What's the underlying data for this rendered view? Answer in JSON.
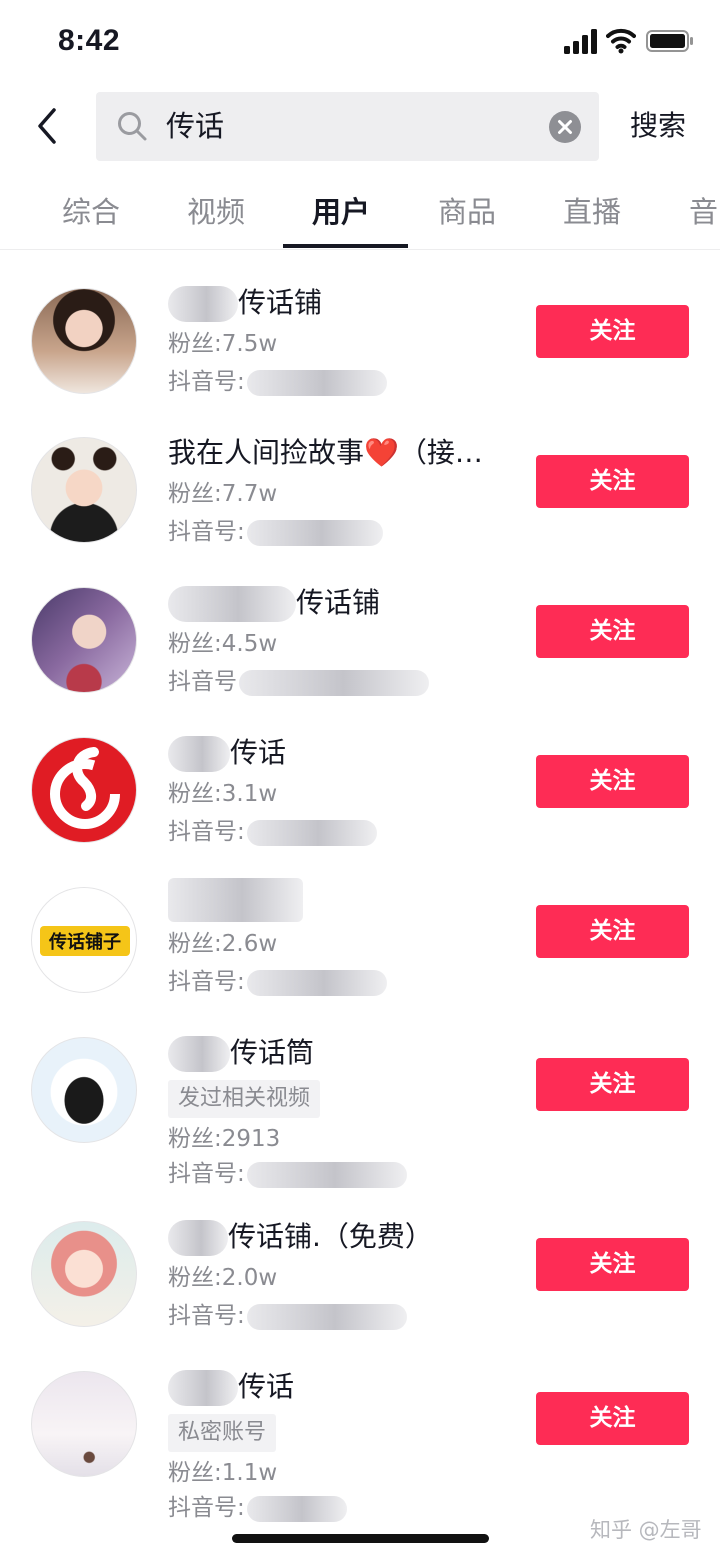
{
  "status_bar": {
    "time": "8:42"
  },
  "search": {
    "query": "传话",
    "button_label": "搜索"
  },
  "tabs": [
    {
      "label": "综合",
      "active": false
    },
    {
      "label": "视频",
      "active": false
    },
    {
      "label": "用户",
      "active": true
    },
    {
      "label": "商品",
      "active": false
    },
    {
      "label": "直播",
      "active": false
    },
    {
      "label": "音",
      "active": false
    }
  ],
  "users": [
    {
      "name": "传话铺",
      "fans": "粉丝:7.5w",
      "id_label": "抖音号:",
      "tag": "",
      "follow": "关注"
    },
    {
      "name": "我在人间捡故事❤️（接…",
      "fans": "粉丝:7.7w",
      "id_label": "抖音号:",
      "tag": "",
      "follow": "关注"
    },
    {
      "name": "传话铺",
      "fans": "粉丝:4.5w",
      "id_label": "抖音号",
      "tag": "",
      "follow": "关注"
    },
    {
      "name": "传话",
      "fans": "粉丝:3.1w",
      "id_label": "抖音号:",
      "tag": "",
      "follow": "关注"
    },
    {
      "name": "",
      "fans": "粉丝:2.6w",
      "id_label": "抖音号:",
      "tag": "",
      "follow": "关注"
    },
    {
      "name": "传话筒",
      "fans": "粉丝:2913",
      "id_label": "抖音号:",
      "tag": "发过相关视频",
      "follow": "关注"
    },
    {
      "name": "传话铺.（免费）",
      "fans": "粉丝:2.0w",
      "id_label": "抖音号:",
      "tag": "",
      "follow": "关注"
    },
    {
      "name": "传话",
      "fans": "粉丝:1.1w",
      "id_label": "抖音号:",
      "tag": "私密账号",
      "follow": "关注"
    }
  ],
  "avatar_text": {
    "logo_5": "传话铺子"
  },
  "watermark": "知乎 @左哥",
  "colors": {
    "follow": "#fe2c55",
    "muted": "#8a8b91",
    "text": "#161823"
  }
}
